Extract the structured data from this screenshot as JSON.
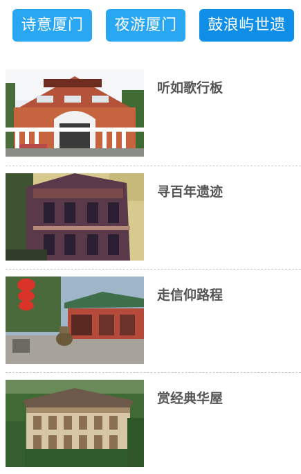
{
  "tabs": [
    {
      "label": "诗意厦门",
      "color": "#2aa7f3"
    },
    {
      "label": "夜游厦门",
      "color": "#2aa7f3"
    },
    {
      "label": "鼓浪屿世遗",
      "color": "#0e8ee6",
      "active": true
    }
  ],
  "articles": [
    {
      "title": "听如歌行板",
      "image": "piano-museum-photo"
    },
    {
      "title": "寻百年遗迹",
      "image": "historic-villa-photo"
    },
    {
      "title": "走信仰路程",
      "image": "temple-courtyard-photo"
    },
    {
      "title": "赏经典华屋",
      "image": "classic-mansion-photo"
    }
  ]
}
